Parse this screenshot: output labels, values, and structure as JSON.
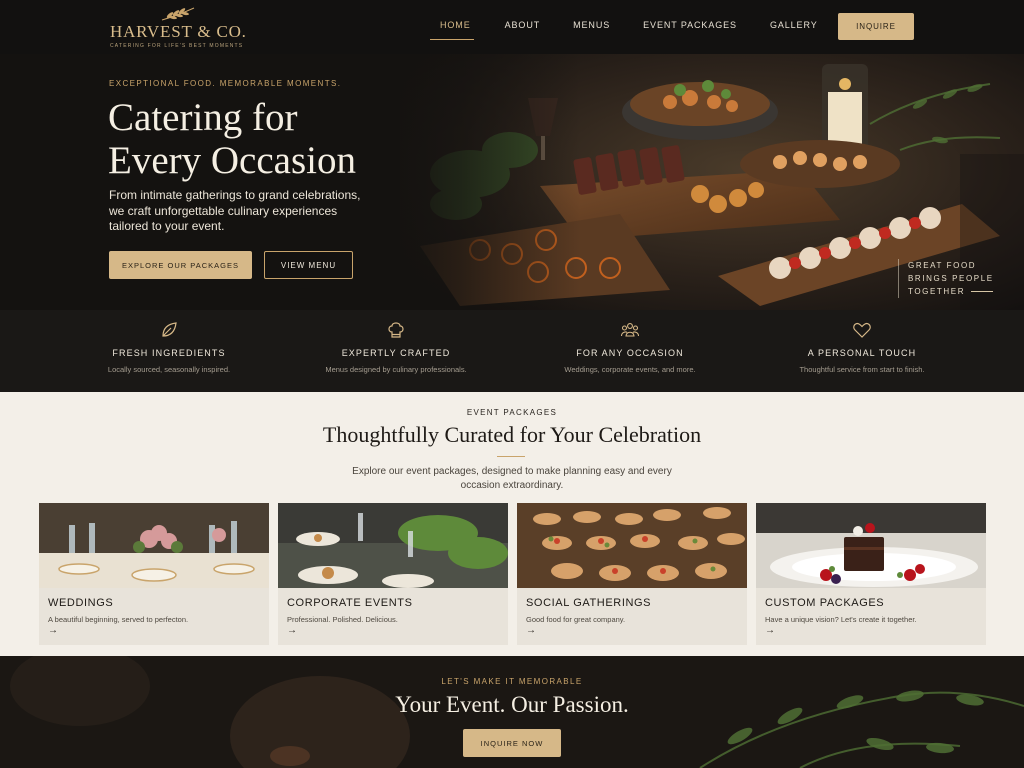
{
  "brand": {
    "name": "HARVEST & CO.",
    "tagline": "CATERING FOR LIFE'S BEST MOMENTS",
    "accent": "#d6b888",
    "dark": "#141210",
    "cream": "#f3efe8"
  },
  "nav": {
    "items": [
      {
        "label": "HOME",
        "active": true
      },
      {
        "label": "ABOUT",
        "active": false
      },
      {
        "label": "MENUS",
        "active": false
      },
      {
        "label": "EVENT PACKAGES",
        "active": false
      },
      {
        "label": "GALLERY",
        "active": false
      }
    ],
    "cta": "INQUIRE"
  },
  "hero": {
    "eyebrow": "EXCEPTIONAL FOOD. MEMORABLE MOMENTS.",
    "title_line1": "Catering for",
    "title_line2": "Every Occasion",
    "description": "From intimate gatherings to grand celebrations, we craft unforgettable culinary experiences tailored to your event.",
    "primary_button": "EXPLORE OUR PACKAGES",
    "secondary_button": "VIEW MENU",
    "quote_line1": "GREAT FOOD",
    "quote_line2": "BRINGS PEOPLE",
    "quote_line3": "TOGETHER"
  },
  "features": [
    {
      "icon": "leaf-icon",
      "title": "FRESH INGREDIENTS",
      "desc": "Locally sourced, seasonally inspired."
    },
    {
      "icon": "chef-hat-icon",
      "title": "EXPERTLY CRAFTED",
      "desc": "Menus designed by culinary professionals."
    },
    {
      "icon": "people-group-icon",
      "title": "FOR ANY OCCASION",
      "desc": "Weddings, corporate events, and more."
    },
    {
      "icon": "heart-icon",
      "title": "A PERSONAL TOUCH",
      "desc": "Thoughtful service from start to finish."
    }
  ],
  "packages": {
    "eyebrow": "EVENT PACKAGES",
    "title": "Thoughtfully Curated for Your Celebration",
    "description": "Explore our event packages, designed to make planning easy and every occasion extraordinary.",
    "cards": [
      {
        "title": "WEDDINGS",
        "desc": "A beautiful beginning, served to perfecton.",
        "arrow": "→"
      },
      {
        "title": "CORPORATE EVENTS",
        "desc": "Professional. Polished. Delicious.",
        "arrow": "→"
      },
      {
        "title": "SOCIAL GATHERINGS",
        "desc": "Good food for great company.",
        "arrow": "→"
      },
      {
        "title": "CUSTOM PACKAGES",
        "desc": "Have a unique vision? Let's create it together.",
        "arrow": "→"
      }
    ]
  },
  "cta": {
    "eyebrow": "LET'S MAKE IT MEMORABLE",
    "title": "Your Event. Our Passion.",
    "button": "INQUIRE NOW"
  }
}
